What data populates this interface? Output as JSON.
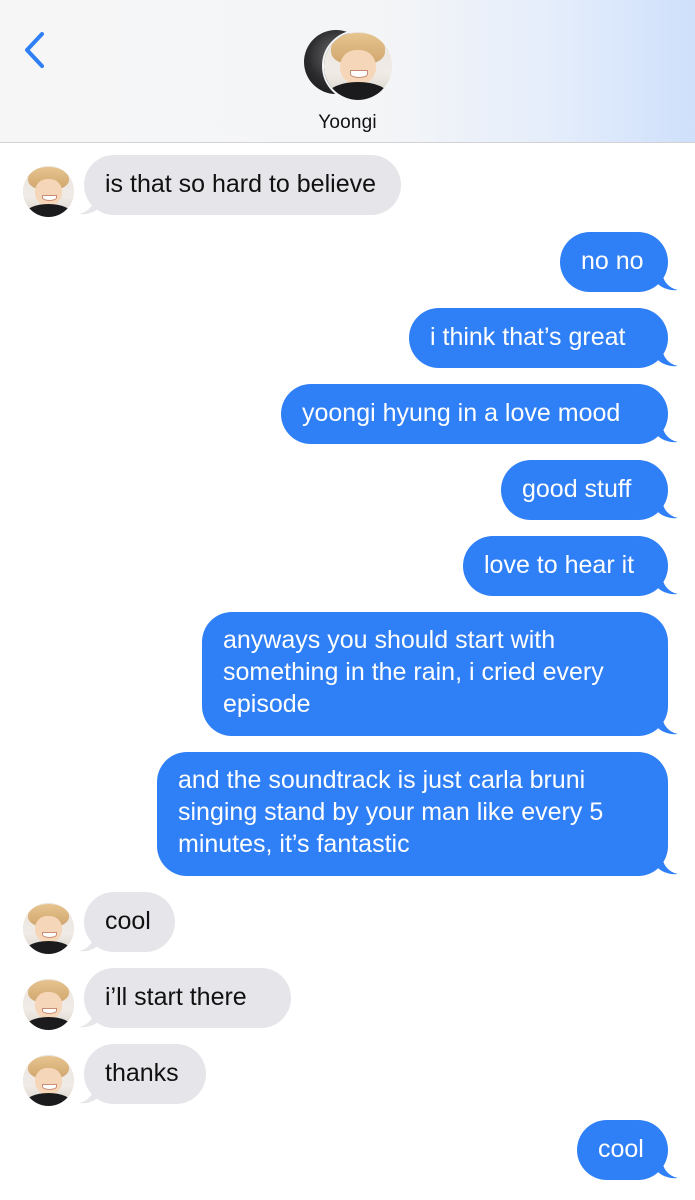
{
  "header": {
    "contact_name": "Yoongi",
    "back_icon": "chevron-left-icon",
    "accent_color": "#2f7ff6"
  },
  "messages": [
    {
      "direction": "incoming",
      "text": "is that so hard to believe"
    },
    {
      "direction": "outgoing",
      "text": "no no"
    },
    {
      "direction": "outgoing",
      "text": "i think that’s great"
    },
    {
      "direction": "outgoing",
      "text": "yoongi hyung in a love mood"
    },
    {
      "direction": "outgoing",
      "text": "good stuff"
    },
    {
      "direction": "outgoing",
      "text": "love to hear it"
    },
    {
      "direction": "outgoing",
      "text": "anyways you should start with something in the rain, i cried every episode"
    },
    {
      "direction": "outgoing",
      "text": "and the soundtrack is just carla bruni singing stand by your man like every 5 minutes, it’s fantastic"
    },
    {
      "direction": "incoming",
      "text": "cool"
    },
    {
      "direction": "incoming",
      "text": "i’ll start there"
    },
    {
      "direction": "incoming",
      "text": "thanks"
    },
    {
      "direction": "outgoing",
      "text": "cool"
    }
  ],
  "colors": {
    "incoming_bubble": "#e5e5ea",
    "outgoing_bubble": "#2f7ff6",
    "header_background": "#f4f5f7"
  }
}
